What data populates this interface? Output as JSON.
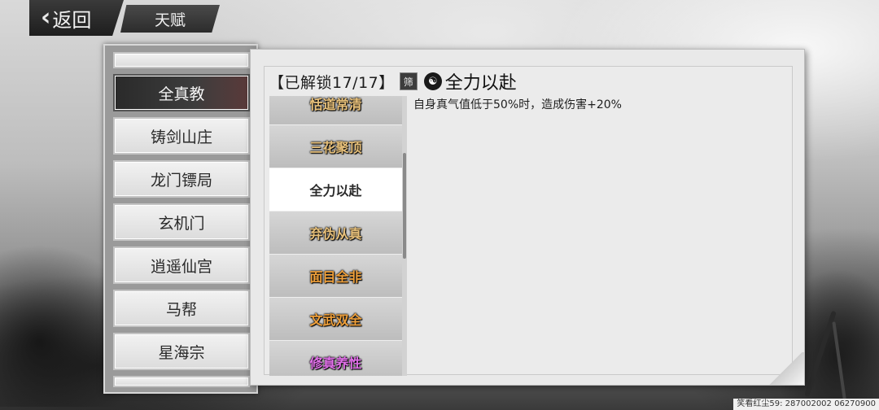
{
  "nav": {
    "back_label": "返回",
    "tab_title": "天赋"
  },
  "sects": [
    {
      "label": "全真教",
      "selected": true
    },
    {
      "label": "铸剑山庄",
      "selected": false
    },
    {
      "label": "龙门镖局",
      "selected": false
    },
    {
      "label": "玄机门",
      "selected": false
    },
    {
      "label": "逍遥仙宫",
      "selected": false
    },
    {
      "label": "马帮",
      "selected": false
    },
    {
      "label": "星海宗",
      "selected": false
    }
  ],
  "talents": {
    "unlock_status": "【已解锁17/17】",
    "filter_icon_label": "筛",
    "items": [
      {
        "label": "恬道常清",
        "color": "#e7c07a"
      },
      {
        "label": "三花聚顶",
        "color": "#e7c07a"
      },
      {
        "label": "全力以赴",
        "color": "#e7c07a",
        "selected": true
      },
      {
        "label": "弃伪从真",
        "color": "#e7c07a"
      },
      {
        "label": "面目全非",
        "color": "#f0a03a"
      },
      {
        "label": "文武双全",
        "color": "#f0a03a"
      },
      {
        "label": "修真养性",
        "color": "#e070e8"
      }
    ]
  },
  "detail": {
    "name": "全力以赴",
    "description": "自身真气值低于50%时，造成伤害+20%"
  },
  "footer": {
    "watermark": "笑看红尘59: 287002002 06270900"
  }
}
